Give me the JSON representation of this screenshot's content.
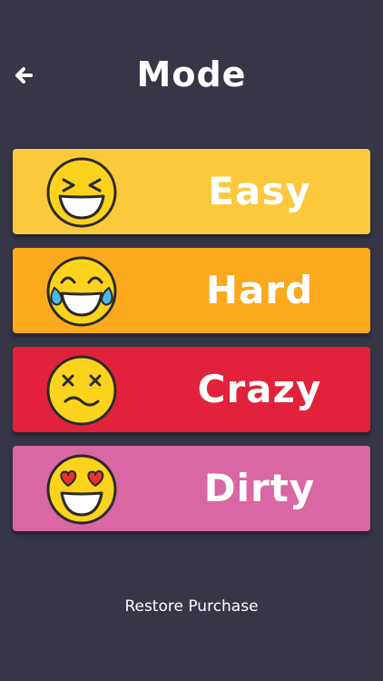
{
  "header": {
    "back_icon": "arrow-left-icon",
    "title": "Mode"
  },
  "modes": [
    {
      "label": "Easy",
      "color": "#fcc93c",
      "icon": "grinning-squint-emoji-icon"
    },
    {
      "label": "Hard",
      "color": "#fba91d",
      "icon": "tears-of-joy-emoji-icon"
    },
    {
      "label": "Crazy",
      "color": "#e2223b",
      "icon": "dizzy-face-emoji-icon"
    },
    {
      "label": "Dirty",
      "color": "#d967a4",
      "icon": "heart-eyes-emoji-icon"
    }
  ],
  "footer": {
    "restore_label": "Restore Purchase"
  },
  "colors": {
    "background": "#363646",
    "emoji_yellow": "#fcd31c",
    "emoji_outline": "#2a2a2a",
    "text": "#ffffff"
  }
}
